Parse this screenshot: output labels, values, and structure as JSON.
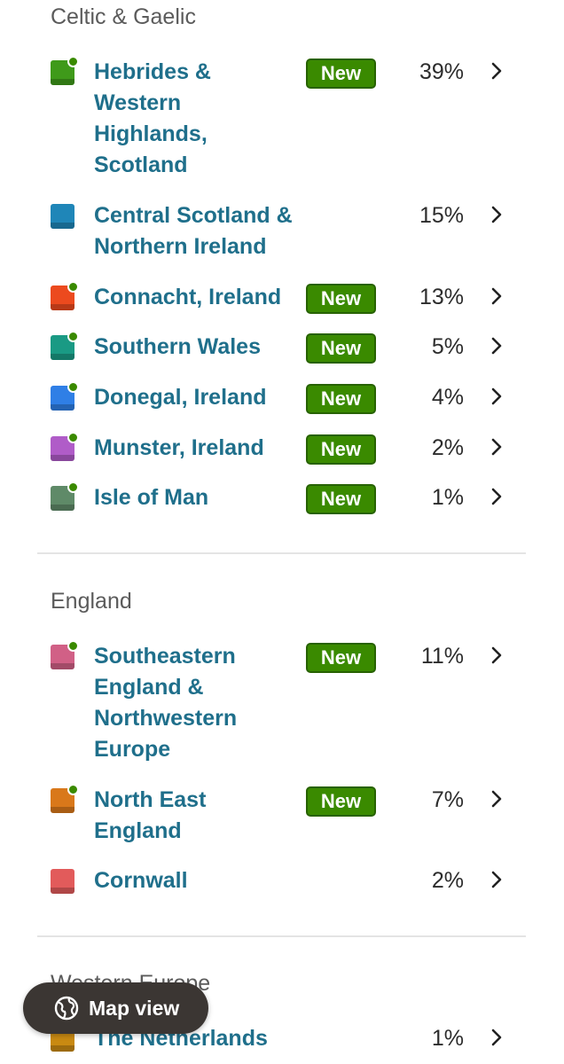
{
  "sections": [
    {
      "title": "Celtic & Gaelic",
      "rows": [
        {
          "name_lines": [
            "Hebrides &",
            "Western",
            "Highlands,",
            "Scotland"
          ],
          "percent": "39%",
          "badge": "New",
          "color": "#3f9a1a",
          "new_dot": true
        },
        {
          "name_lines": [
            "Central Scotland &",
            "Northern Ireland"
          ],
          "percent": "15%",
          "badge": "",
          "color": "#1f86b8",
          "new_dot": false
        },
        {
          "name_lines": [
            "Connacht, Ireland"
          ],
          "percent": "13%",
          "badge": "New",
          "color": "#ec4a1e",
          "new_dot": true
        },
        {
          "name_lines": [
            "Southern Wales"
          ],
          "percent": "5%",
          "badge": "New",
          "color": "#1a9a84",
          "new_dot": true
        },
        {
          "name_lines": [
            "Donegal, Ireland"
          ],
          "percent": "4%",
          "badge": "New",
          "color": "#2f7fe6",
          "new_dot": true
        },
        {
          "name_lines": [
            "Munster, Ireland"
          ],
          "percent": "2%",
          "badge": "New",
          "color": "#b05cc8",
          "new_dot": true
        },
        {
          "name_lines": [
            "Isle of Man"
          ],
          "percent": "1%",
          "badge": "New",
          "color": "#5f8a68",
          "new_dot": true
        }
      ]
    },
    {
      "title": "England",
      "rows": [
        {
          "name_lines": [
            "Southeastern",
            "England &",
            "Northwestern",
            "Europe"
          ],
          "percent": "11%",
          "badge": "New",
          "color": "#d16086",
          "new_dot": true
        },
        {
          "name_lines": [
            "North East",
            "England"
          ],
          "percent": "7%",
          "badge": "New",
          "color": "#d9781a",
          "new_dot": true
        },
        {
          "name_lines": [
            "Cornwall"
          ],
          "percent": "2%",
          "badge": "",
          "color": "#e25b5b",
          "new_dot": false
        }
      ]
    },
    {
      "title": "Western Europe",
      "rows": [
        {
          "name_lines": [
            "The Netherlands"
          ],
          "percent": "1%",
          "badge": "",
          "color": "#c98a12",
          "new_dot": false
        }
      ]
    }
  ],
  "map_button": {
    "label": "Map view",
    "icon": "globe-icon"
  },
  "chevron_icon": "chevron-right-icon"
}
